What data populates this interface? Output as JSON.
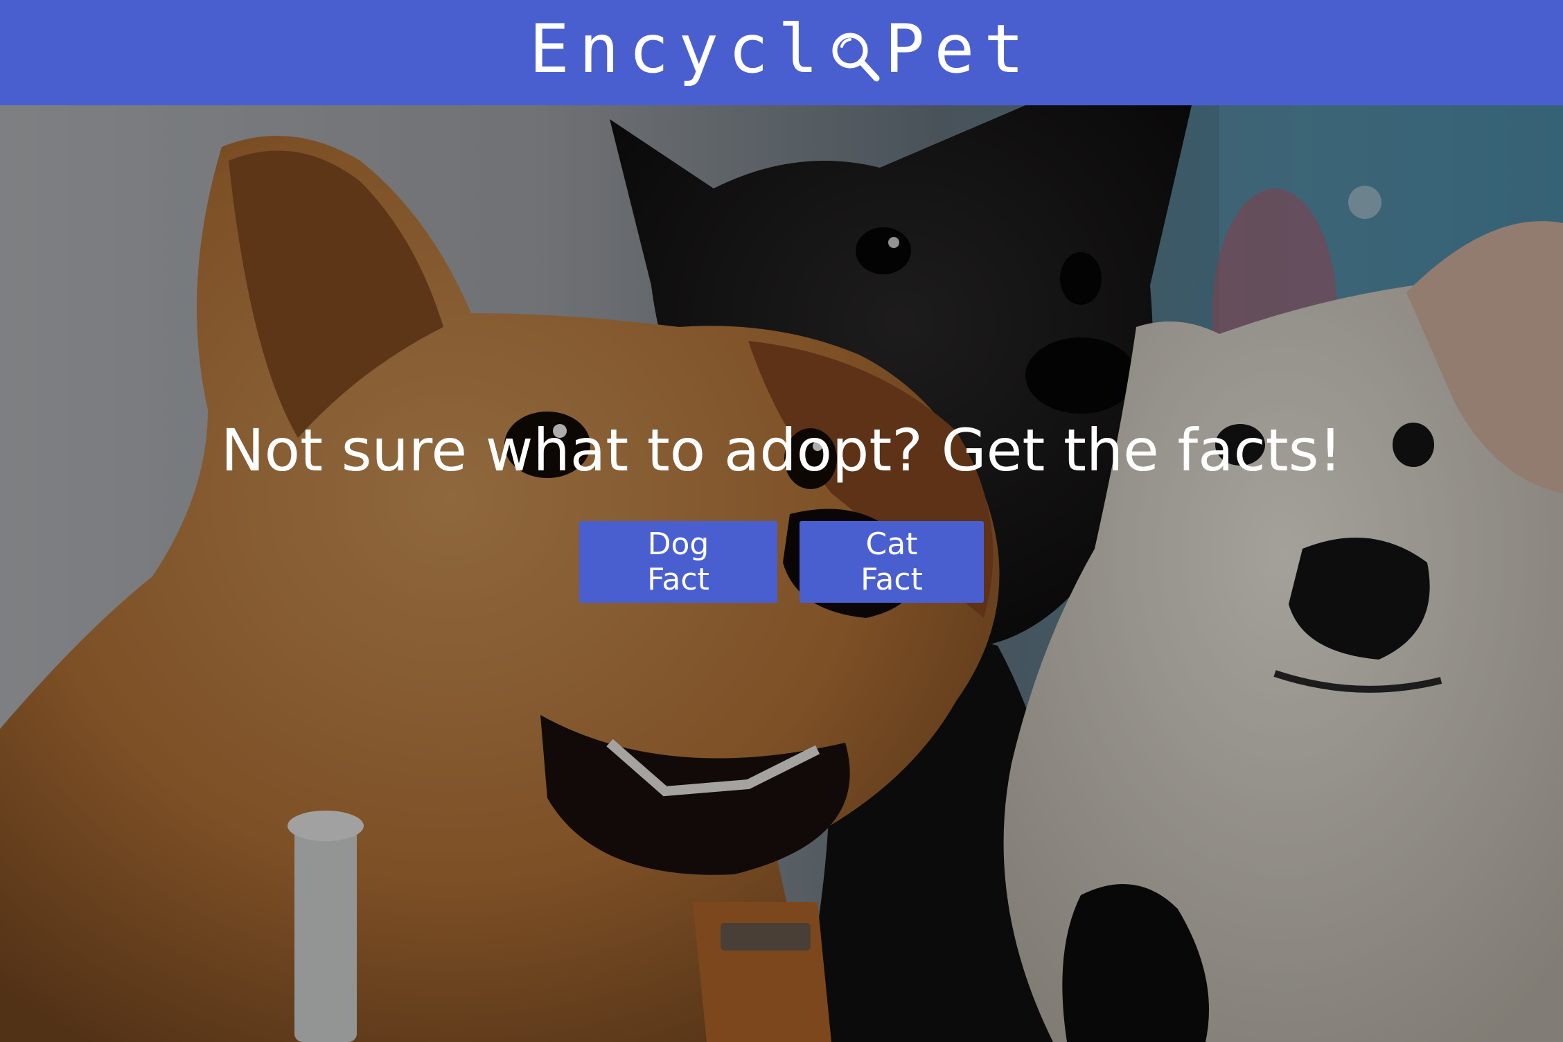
{
  "header": {
    "logo_prefix": "Encycl",
    "logo_icon": "magnifying-glass-icon",
    "logo_suffix": "Pet",
    "background_color": "#4a5fcf"
  },
  "hero": {
    "headline": "Not sure what to adopt? Get the facts!",
    "buttons": {
      "dog_label": "Dog Fact",
      "cat_label": "Cat Fact"
    },
    "button_color": "#4a5fcf"
  }
}
